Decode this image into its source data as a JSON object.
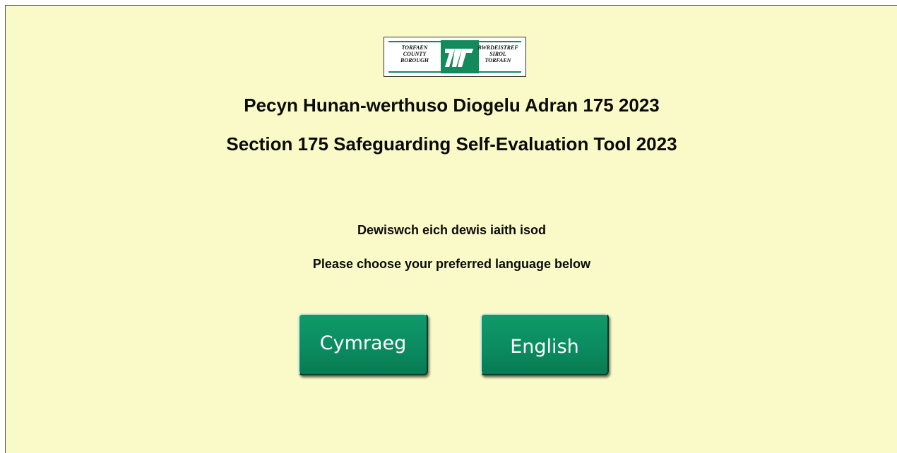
{
  "logo": {
    "left_lines": [
      "TORFAEN",
      "COUNTY",
      "BOROUGH"
    ],
    "right_lines": [
      "BWRDEISTREF",
      "SIROL",
      "TORFAEN"
    ],
    "accent_color": "#138a5c"
  },
  "titles": {
    "welsh": "Pecyn Hunan-werthuso Diogelu Adran 175 2023",
    "english": "Section 175 Safeguarding Self-Evaluation Tool 2023"
  },
  "prompts": {
    "welsh": "Dewiswch eich dewis iaith isod",
    "english": "Please choose your preferred language below"
  },
  "buttons": {
    "welsh_label": "Cymraeg",
    "english_label": "English",
    "color": "#0b8a5f"
  },
  "background_color": "#fafac8"
}
